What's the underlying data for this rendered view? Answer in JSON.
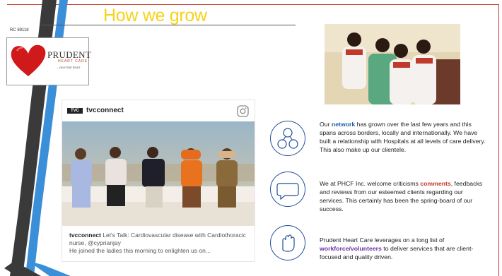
{
  "slide": {
    "title": "How we grow",
    "ref_code": "RC 89118"
  },
  "logo": {
    "name": "PRUDENT",
    "sub": "HEART CARE",
    "tagline": "...save that heart"
  },
  "instagram": {
    "badge": "TVC",
    "username": "tvcconnect",
    "caption_user": "tvcconnect",
    "caption_text": " Let's Talk: Cardiovascular disease with Cardiothoracic nurse, @cyprianjay",
    "caption_more": "He joined the ladies this morning to enlighten us on..."
  },
  "rows": [
    {
      "icon": "network-icon",
      "before": "Our ",
      "highlight": "network",
      "after": " has grown over the last few years and this spans across borders, locally and internationally. We have built a relationship with Hospitals at all levels of care delivery. This also make up our clientele."
    },
    {
      "icon": "comment-icon",
      "before": "We at PHCF Inc. welcome criticisms ",
      "highlight": "comments",
      "after": ", feedbacks and reviews from our esteemed clients regarding our services. This certainly has been the spring-board of our success."
    },
    {
      "icon": "hand-icon",
      "before": "Prudent Heart Care leverages on a long list of ",
      "highlight": "workforce/volunteers",
      "after": " to deliver services that are client-focused and quality driven."
    }
  ],
  "colors": {
    "title": "#f5d21a",
    "accent_blue": "#1f5fa8",
    "accent_red": "#c0392b",
    "accent_purple": "#6b2fa5",
    "stripe_dark": "#3a3a3a",
    "stripe_blue": "#3b8fd9"
  }
}
